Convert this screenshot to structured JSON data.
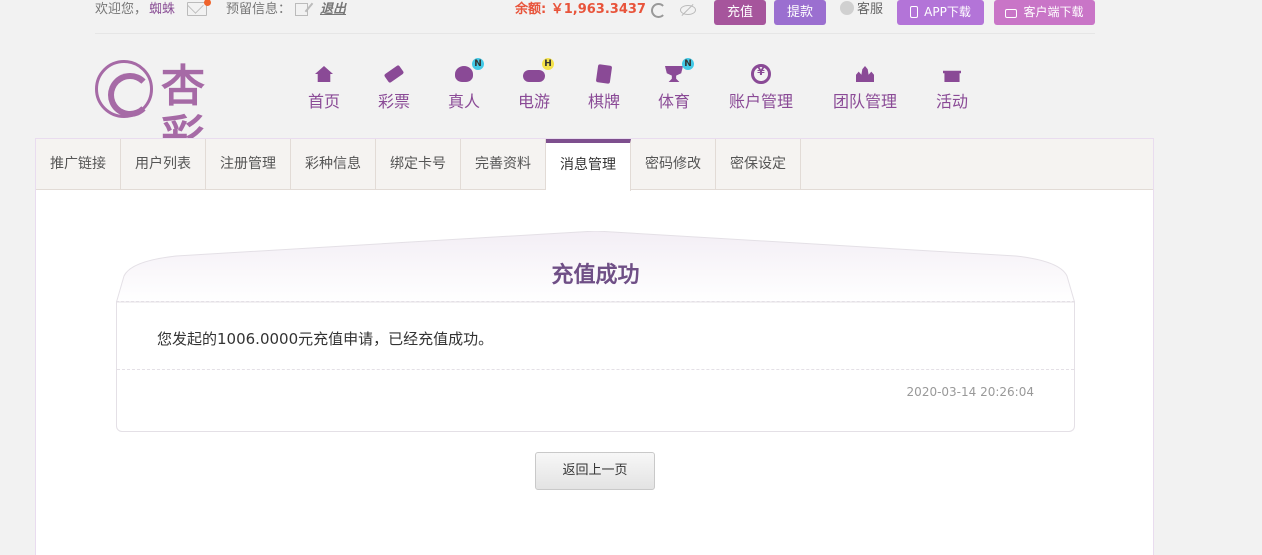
{
  "topbar": {
    "welcome": "欢迎您，",
    "username": "蜘蛛",
    "reserve_label": "预留信息：",
    "logout": "退出",
    "balance_label": "余额:",
    "balance_amount": "￥1,963.3437",
    "recharge": "充值",
    "withdraw": "提款",
    "service": "客服",
    "app_download": "APP下载",
    "client_download": "客户端下载"
  },
  "logo": {
    "text": "杏彩"
  },
  "nav": [
    {
      "label": "首页",
      "icon": "home-icon"
    },
    {
      "label": "彩票",
      "icon": "lottery-ticket-icon"
    },
    {
      "label": "真人",
      "icon": "live-dealer-icon",
      "badge": "N"
    },
    {
      "label": "电游",
      "icon": "gamepad-icon",
      "badge": "H"
    },
    {
      "label": "棋牌",
      "icon": "cards-icon"
    },
    {
      "label": "体育",
      "icon": "trophy-icon",
      "badge": "N"
    },
    {
      "label": "账户管理",
      "icon": "yuan-coin-icon"
    },
    {
      "label": "团队管理",
      "icon": "team-icon"
    },
    {
      "label": "活动",
      "icon": "gift-icon"
    }
  ],
  "tabs": [
    "推广链接",
    "用户列表",
    "注册管理",
    "彩种信息",
    "绑定卡号",
    "完善资料",
    "消息管理",
    "密码修改",
    "密保设定"
  ],
  "active_tab": "消息管理",
  "message": {
    "title": "充值成功",
    "body": "您发起的1006.0000元充值申请，已经充值成功。",
    "time": "2020-03-14 20:26:04"
  },
  "back_button": "返回上一页",
  "colors": {
    "brand": "#8a4a96",
    "balance": "#e8543b",
    "recharge_btn": "#a6559c",
    "withdraw_btn": "#9b6fd0",
    "app_btn": "#b374d8",
    "client_btn": "#c975c7"
  }
}
